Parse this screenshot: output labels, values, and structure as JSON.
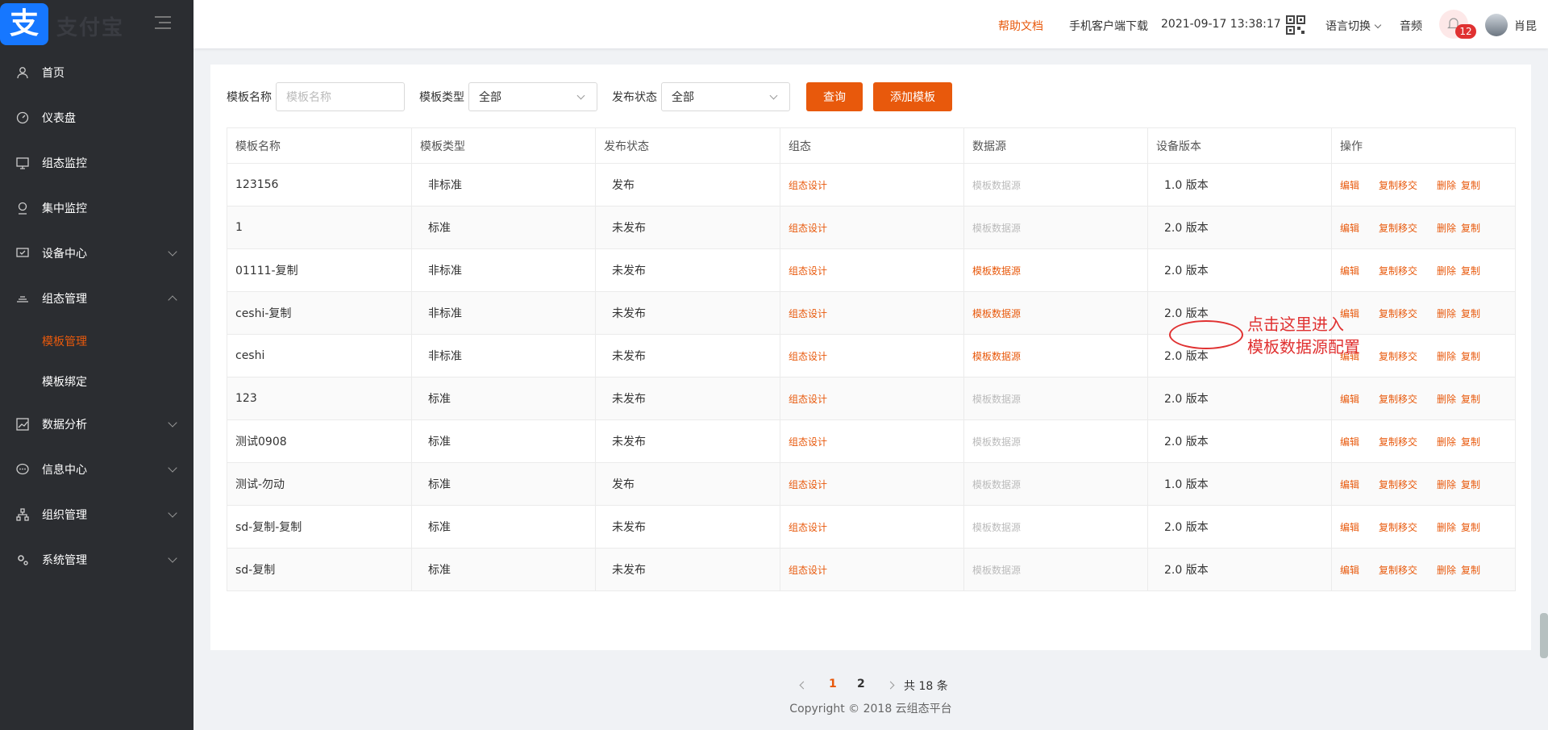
{
  "logo": {
    "text": "支付宝",
    "glyph": "支"
  },
  "sidebar": {
    "items": [
      {
        "label": "首页",
        "icon": "user-icon"
      },
      {
        "label": "仪表盘",
        "icon": "dashboard-icon"
      },
      {
        "label": "组态监控",
        "icon": "monitor-icon"
      },
      {
        "label": "集中监控",
        "icon": "location-icon"
      },
      {
        "label": "设备中心",
        "icon": "device-icon",
        "expandable": true
      },
      {
        "label": "组态管理",
        "icon": "layers-icon",
        "expanded": true
      },
      {
        "label": "数据分析",
        "icon": "chart-icon",
        "expandable": true
      },
      {
        "label": "信息中心",
        "icon": "message-icon",
        "expandable": true
      },
      {
        "label": "组织管理",
        "icon": "org-icon",
        "expandable": true
      },
      {
        "label": "系统管理",
        "icon": "settings-icon",
        "expandable": true
      }
    ],
    "subitems": [
      {
        "label": "模板管理",
        "active": true
      },
      {
        "label": "模板绑定",
        "active": false
      }
    ]
  },
  "header": {
    "help": "帮助文档",
    "download": "手机客户端下载",
    "datetime": "2021-09-17 13:38:17",
    "language": "语言切换",
    "audio": "音频",
    "notification_count": "12",
    "username": "肖昆"
  },
  "filters": {
    "name_label": "模板名称",
    "name_placeholder": "模板名称",
    "type_label": "模板类型",
    "type_value": "全部",
    "status_label": "发布状态",
    "status_value": "全部",
    "query_button": "查询",
    "add_button": "添加模板"
  },
  "table": {
    "headers": [
      "模板名称",
      "模板类型",
      "发布状态",
      "组态",
      "数据源",
      "设备版本",
      "操作"
    ],
    "rows": [
      {
        "name": "123156",
        "type": "非标准",
        "status": "发布",
        "design": "组态设计",
        "source": "模板数据源",
        "source_enabled": false,
        "version": "1.0 版本"
      },
      {
        "name": "1",
        "type": "标准",
        "status": "未发布",
        "design": "组态设计",
        "source": "模板数据源",
        "source_enabled": false,
        "version": "2.0 版本"
      },
      {
        "name": "01111-复制",
        "type": "非标准",
        "status": "未发布",
        "design": "组态设计",
        "source": "模板数据源",
        "source_enabled": true,
        "version": "2.0 版本"
      },
      {
        "name": "ceshi-复制",
        "type": "非标准",
        "status": "未发布",
        "design": "组态设计",
        "source": "模板数据源",
        "source_enabled": true,
        "version": "2.0 版本"
      },
      {
        "name": "ceshi",
        "type": "非标准",
        "status": "未发布",
        "design": "组态设计",
        "source": "模板数据源",
        "source_enabled": true,
        "version": "2.0 版本"
      },
      {
        "name": "123",
        "type": "标准",
        "status": "未发布",
        "design": "组态设计",
        "source": "模板数据源",
        "source_enabled": false,
        "version": "2.0 版本"
      },
      {
        "name": "测试0908",
        "type": "标准",
        "status": "未发布",
        "design": "组态设计",
        "source": "模板数据源",
        "source_enabled": false,
        "version": "2.0 版本"
      },
      {
        "name": "测试-勿动",
        "type": "标准",
        "status": "发布",
        "design": "组态设计",
        "source": "模板数据源",
        "source_enabled": false,
        "version": "1.0 版本"
      },
      {
        "name": "sd-复制-复制",
        "type": "标准",
        "status": "未发布",
        "design": "组态设计",
        "source": "模板数据源",
        "source_enabled": false,
        "version": "2.0 版本"
      },
      {
        "name": "sd-复制",
        "type": "标准",
        "status": "未发布",
        "design": "组态设计",
        "source": "模板数据源",
        "source_enabled": false,
        "version": "2.0 版本"
      }
    ],
    "ops": [
      "编辑",
      "复制移交",
      "删除",
      "复制"
    ]
  },
  "annotation": {
    "line1": "点击这里进入",
    "line2": "模板数据源配置"
  },
  "pagination": {
    "page1": "1",
    "page2": "2",
    "total": "共 18 条"
  },
  "footer": "Copyright © 2018 云组态平台",
  "colors": {
    "accent": "#e8590c",
    "sidebar": "#2b2d31",
    "annotation": "#e03131"
  }
}
